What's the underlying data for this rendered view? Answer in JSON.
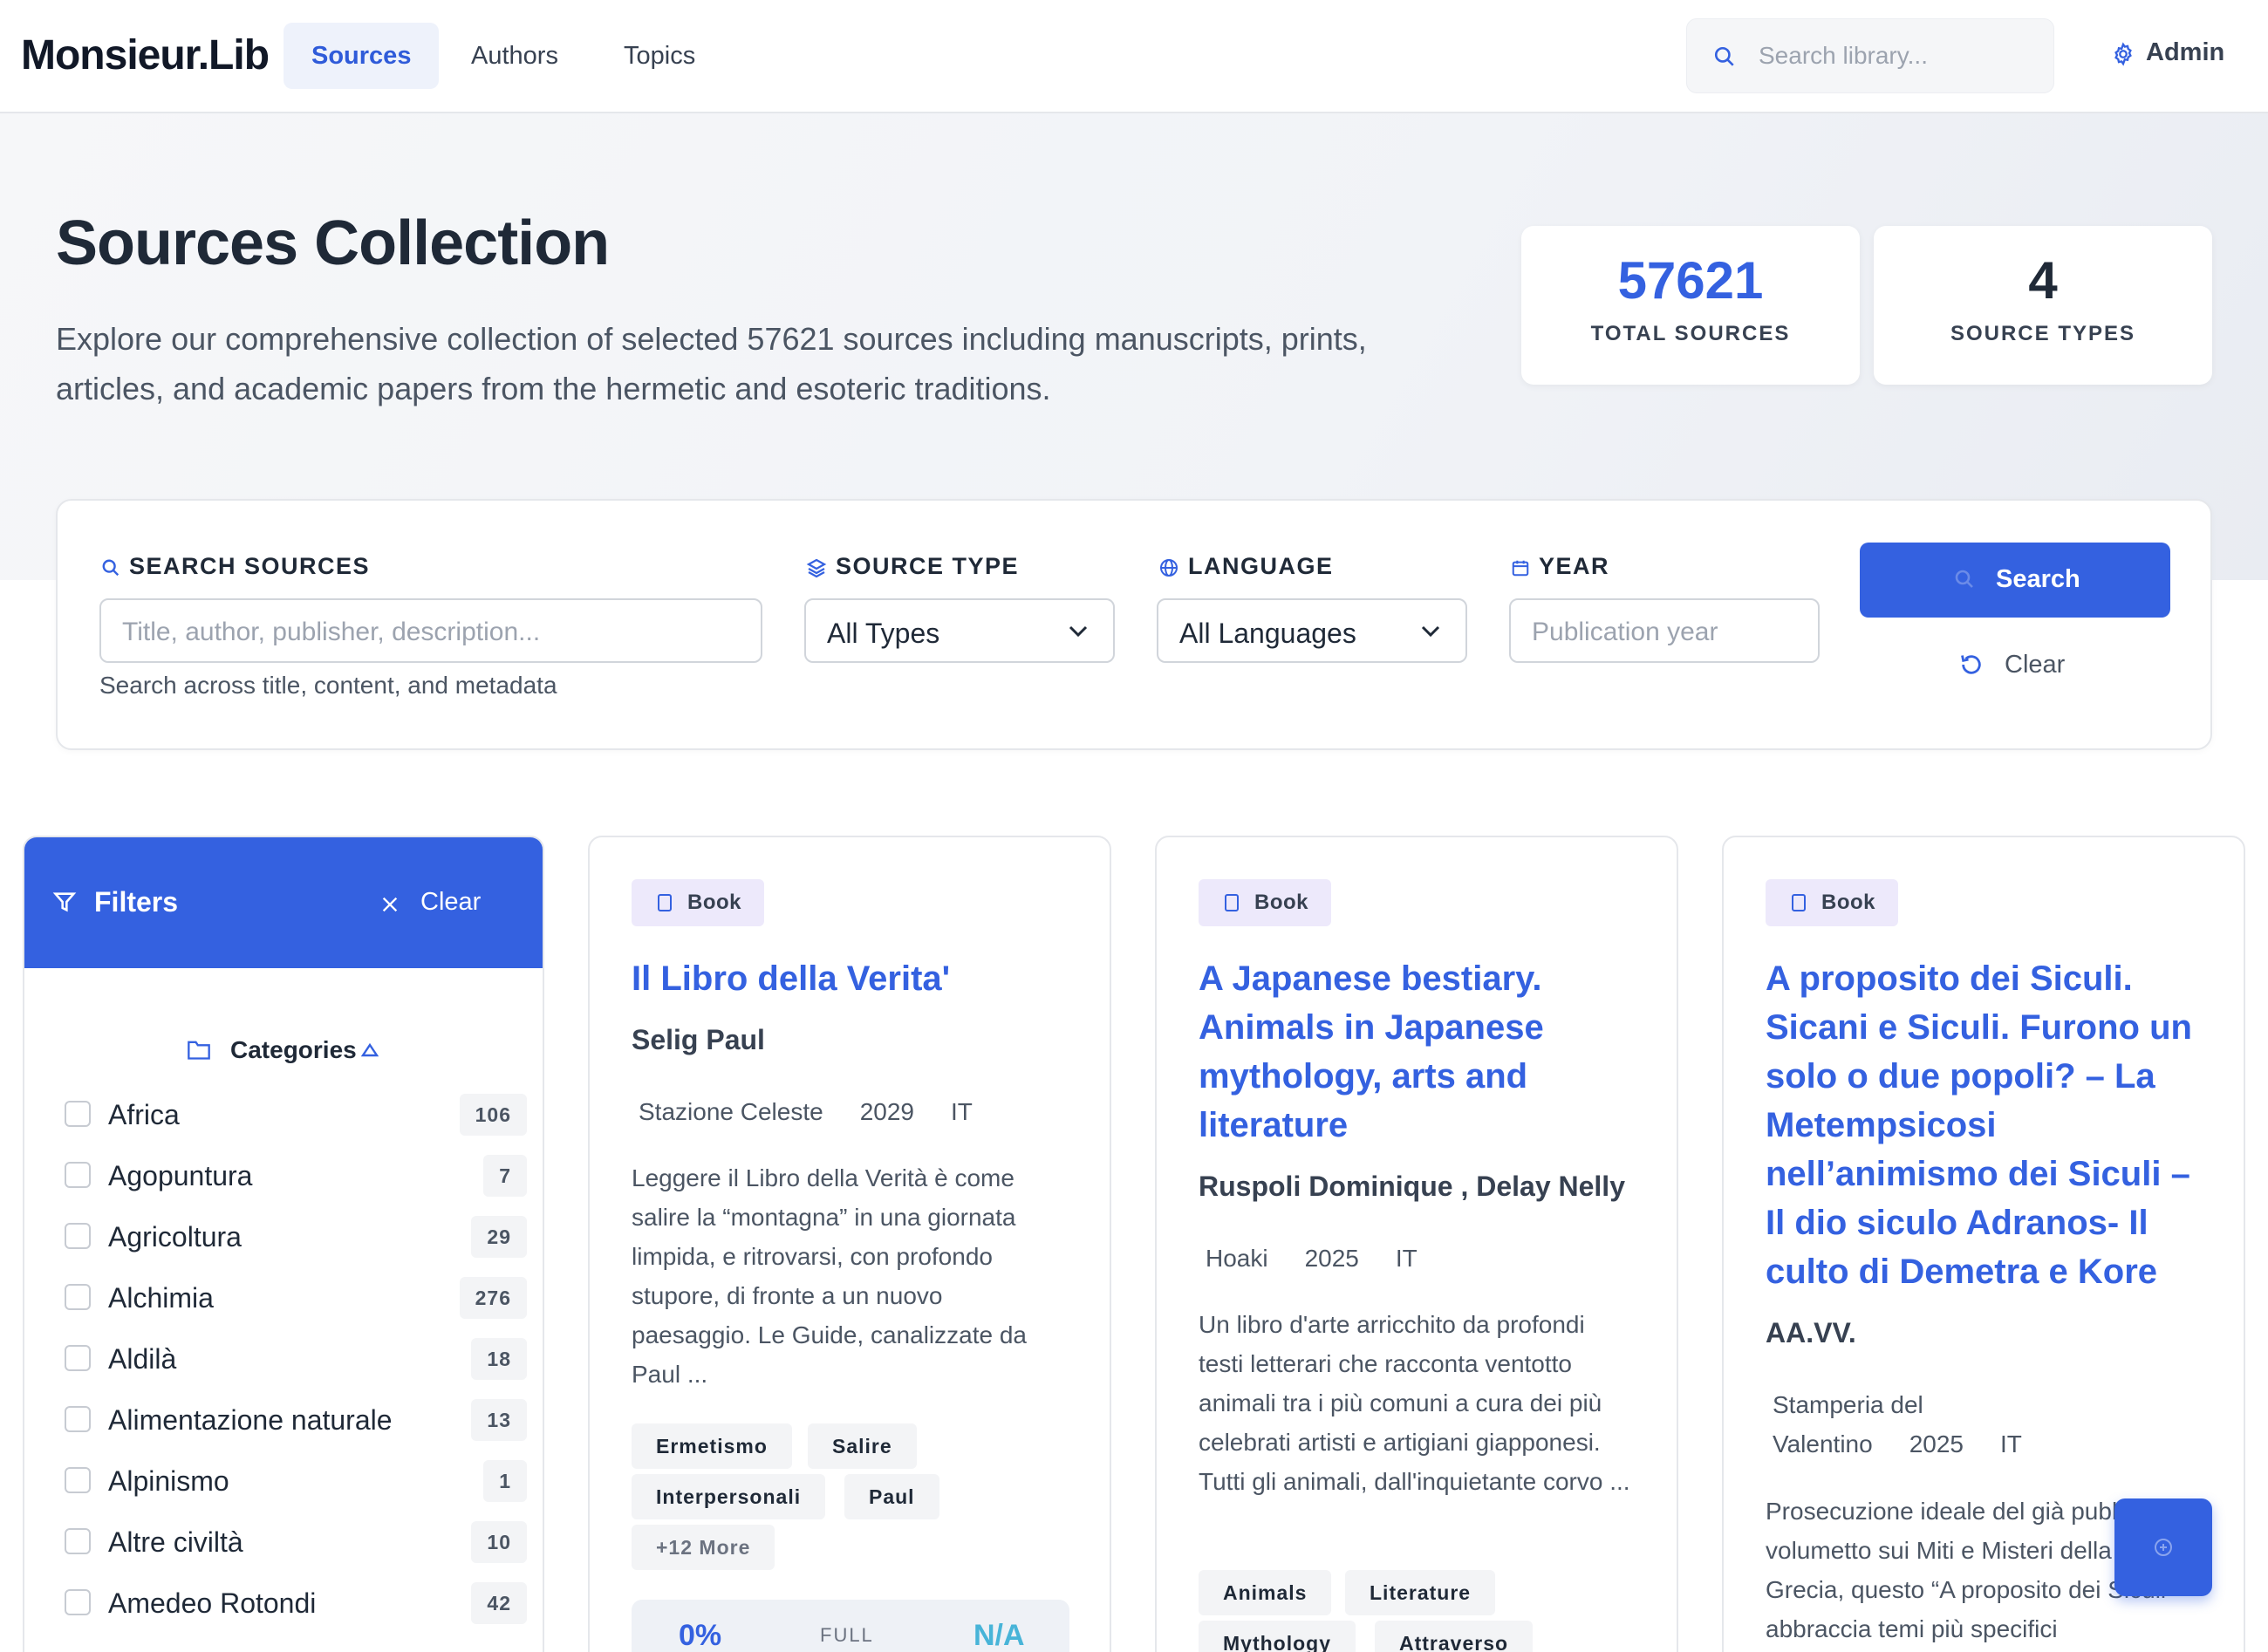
{
  "nav": {
    "brand": "Monsieur.Lib",
    "links": [
      "Sources",
      "Authors",
      "Topics"
    ],
    "search_placeholder": "Search library...",
    "admin_label": "Admin"
  },
  "hero": {
    "title": "Sources Collection",
    "description": "Explore our comprehensive collection of selected 57621 sources including manuscripts, prints, articles, and academic papers from the hermetic and esoteric traditions.",
    "stats": [
      {
        "value": "57621",
        "label": "TOTAL SOURCES",
        "color": "#3461e0"
      },
      {
        "value": "4",
        "label": "SOURCE TYPES",
        "color": "#1f2937"
      }
    ]
  },
  "search_panel": {
    "search_label": "SEARCH SOURCES",
    "search_placeholder": "Title, author, publisher, description...",
    "search_help": "Search across title, content, and metadata",
    "type_label": "SOURCE TYPE",
    "type_value": "All Types",
    "language_label": "LANGUAGE",
    "language_value": "All Languages",
    "year_label": "YEAR",
    "year_placeholder": "Publication year",
    "search_button": "Search",
    "clear_button": "Clear"
  },
  "filters": {
    "title": "Filters",
    "clear_label": "Clear",
    "categories_title": "Categories",
    "categories": [
      {
        "name": "Africa",
        "count": "106"
      },
      {
        "name": "Agopuntura",
        "count": "7"
      },
      {
        "name": "Agricoltura",
        "count": "29"
      },
      {
        "name": "Alchimia",
        "count": "276"
      },
      {
        "name": "Aldilà",
        "count": "18"
      },
      {
        "name": "Alimentazione naturale",
        "count": "13"
      },
      {
        "name": "Alpinismo",
        "count": "1"
      },
      {
        "name": "Altre civiltà",
        "count": "10"
      },
      {
        "name": "Amedeo Rotondi",
        "count": "42"
      }
    ]
  },
  "cards": [
    {
      "type": "Book",
      "title": "Il Libro della Verita'",
      "author": "Selig Paul",
      "publisher": "Stazione Celeste",
      "year": "2029",
      "lang": "IT",
      "description": "Leggere il Libro della Verità è come salire la “montagna” in una giornata limpida, e ritrovarsi, con profondo stupore, di fronte a un nuovo paesaggio. Le Guide, canalizzate da Paul ...",
      "tags": [
        "Ermetismo",
        "Salire",
        "Interpersonali",
        "Paul"
      ],
      "more": "+12 More",
      "footer": {
        "percent": "0%",
        "full": "FULL",
        "na": "N/A"
      }
    },
    {
      "type": "Book",
      "title": "A Japanese bestiary. Animals in Japanese mythology, arts and literature",
      "author": "Ruspoli Dominique , Delay Nelly",
      "publisher": "Hoaki",
      "year": "2025",
      "lang": "IT",
      "description": "Un libro d'arte arricchito da profondi testi letterari che racconta ventotto animali tra i più comuni a cura dei più celebrati artisti e artigiani giapponesi. Tutti gli animali, dall'inquietante corvo ...",
      "tags": [
        "Animals",
        "Literature",
        "Mythology",
        "Attraverso"
      ]
    },
    {
      "type": "Book",
      "title": "A proposito dei Siculi. Sicani e Siculi. Furono un solo o due popoli? – La Metempsicosi nell’animismo dei Siculi – Il dio siculo Adranos- Il culto di Demetra e Kore",
      "author": "AA.VV.",
      "publisher": "Stamperia del Valentino",
      "year": "2025",
      "lang": "IT",
      "description": "Prosecuzione ideale del già pubblicato volumetto sui Miti e Misteri della Magna Grecia, questo “A proposito dei Siculi” abbraccia temi più specifici"
    }
  ],
  "colors": {
    "accent": "#3461e0",
    "badge_bg": "#ede9fb",
    "na": "#48b4d8"
  }
}
